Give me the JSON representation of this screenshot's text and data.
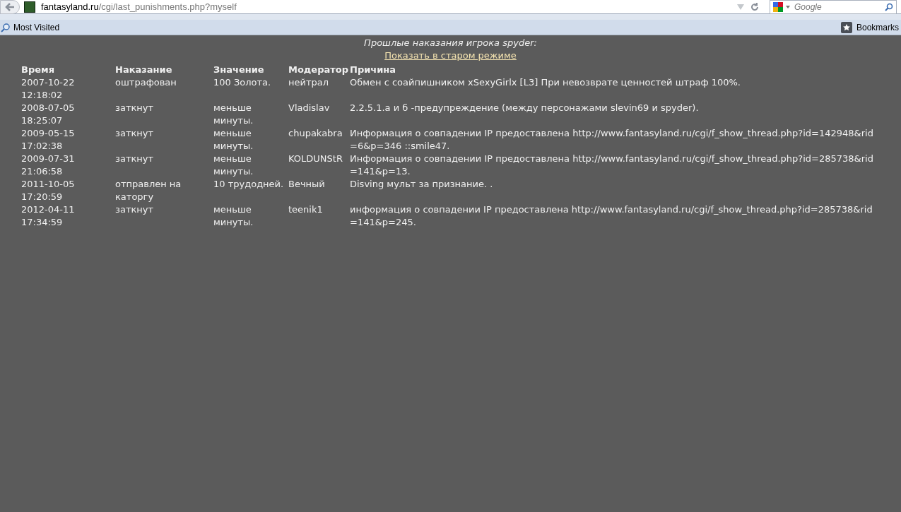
{
  "browser": {
    "url_domain": "fantasyland.ru",
    "url_path": "/cgi/last_punishments.php?myself",
    "search_placeholder": "Google",
    "bookmarks_bar": [
      "Most Visited"
    ],
    "bookmarks_menu": "Bookmarks"
  },
  "page": {
    "heading": "Прошлые наказания игрока spyder:",
    "old_mode_link": "Показать в старом режиме",
    "columns": [
      "Время",
      "Наказание",
      "Значение",
      "Модератор",
      "Причина"
    ],
    "rows": [
      {
        "cells": [
          "2007-10-22 12:18:02",
          "оштрафован",
          "100 Золота.",
          "нейтрал",
          "Обмен с соайпишником xSexyGirlx [L3] При невозврате ценностей штраф 100%."
        ]
      },
      {
        "cells": [
          "2008-07-05 18:25:07",
          "заткнут",
          "меньше минуты.",
          "Vladislav",
          "2.2.5.1.а и б -предупреждение (между персонажами slevin69 и spyder)."
        ]
      },
      {
        "cells": [
          "2009-05-15 17:02:38",
          "заткнут",
          "меньше минуты.",
          "chupakabra",
          "Информация о совпадении IP предоставлена http://www.fantasyland.ru/cgi/f_show_thread.php?id=142948&rid=6&p=346 ::smile47."
        ]
      },
      {
        "cells": [
          "2009-07-31 21:06:58",
          "заткнут",
          "меньше минуты.",
          "KOLDUNStR",
          "Информация о совпадении IP предоставлена http://www.fantasyland.ru/cgi/f_show_thread.php?id=285738&rid=141&p=13."
        ]
      },
      {
        "cells": [
          "2011-10-05 17:20:59",
          "отправлен на каторгу",
          "10 трудодней.",
          "Вечный",
          "Disving мульт за признание. ."
        ]
      },
      {
        "cells": [
          "2012-04-11 17:34:59",
          "заткнут",
          "меньше минуты.",
          "teenik1",
          "информация о совпадении IP предоставлена http://www.fantasyland.ru/cgi/f_show_thread.php?id=285738&rid=141&p=245."
        ]
      }
    ]
  }
}
